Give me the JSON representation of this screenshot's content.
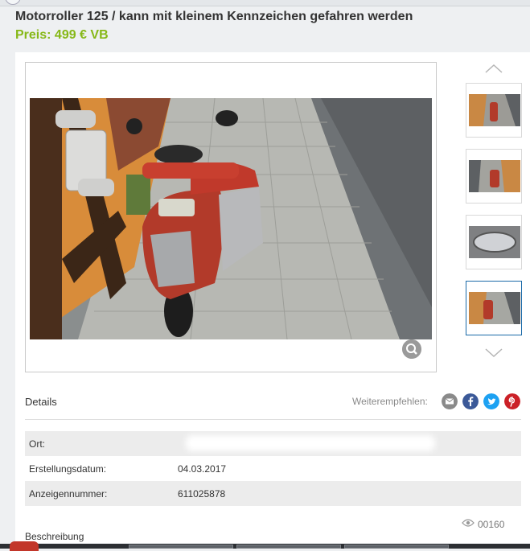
{
  "listing": {
    "title": "Motorroller 125 / kann mit kleinem Kennzeichen gefahren werden",
    "price": "Preis: 499 € VB"
  },
  "gallery": {
    "zoom_icon": "zoom-icon",
    "thumbnails": [
      "thumbnail-1",
      "thumbnail-2",
      "thumbnail-3",
      "thumbnail-4"
    ],
    "active_thumbnail": 4
  },
  "details": {
    "heading": "Details",
    "share_label": "Weiterempfehlen:",
    "share_icons": [
      "mail-icon",
      "facebook-icon",
      "twitter-icon",
      "pinterest-icon"
    ],
    "share_colors": {
      "mail": "#8a8a8a",
      "facebook": "#3b5998",
      "twitter": "#1da1f2",
      "pinterest": "#cb2027"
    },
    "rows": [
      {
        "key": "Ort:",
        "value": ""
      },
      {
        "key": "Erstellungsdatum:",
        "value": "04.03.2017"
      },
      {
        "key": "Anzeigennummer:",
        "value": "611025878"
      }
    ]
  },
  "views": "00160",
  "description": {
    "heading": "Beschreibung"
  },
  "colors": {
    "price": "#86b817",
    "active_border": "#1a6aa8"
  }
}
